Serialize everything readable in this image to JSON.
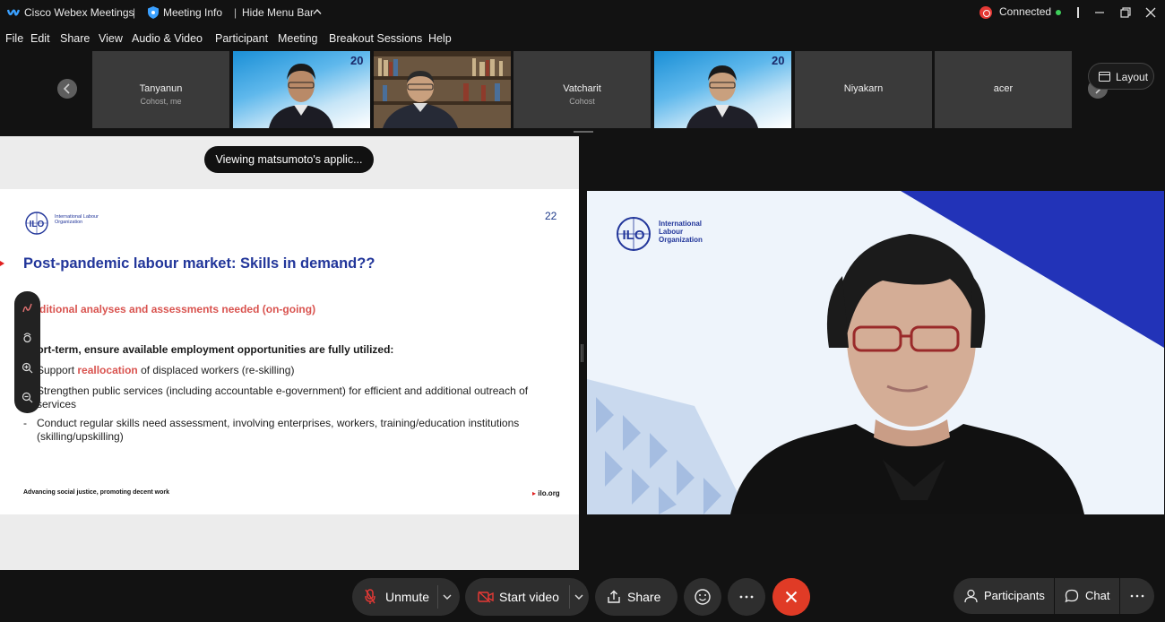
{
  "titlebar": {
    "app_name": "Cisco Webex Meetings",
    "separator": "|",
    "meeting_info": "Meeting Info",
    "hide_menu_bar": "Hide Menu Bar",
    "status": "Connected"
  },
  "menu": {
    "items": [
      "File",
      "Edit",
      "Share",
      "View",
      "Audio & Video",
      "Participant",
      "Meeting",
      "Breakout Sessions",
      "Help"
    ]
  },
  "thumbnails": [
    {
      "name": "Tanyanun",
      "subtitle": "Cohost, me",
      "type": "name"
    },
    {
      "name": "",
      "subtitle": "",
      "type": "video-blue",
      "badge": "20"
    },
    {
      "name": "",
      "subtitle": "",
      "type": "video-shelf"
    },
    {
      "name": "Vatcharit",
      "subtitle": "Cohost",
      "type": "name"
    },
    {
      "name": "",
      "subtitle": "",
      "type": "video-blue",
      "badge": "20"
    },
    {
      "name": "Niyakarn",
      "subtitle": "",
      "type": "name"
    },
    {
      "name": "acer",
      "subtitle": "",
      "type": "name"
    }
  ],
  "layout_button": "Layout",
  "viewing_notice": "Viewing matsumoto's applic...",
  "slide": {
    "page_number": "22",
    "logo_text": "International Labour Organization",
    "title": "Post-pandemic labour market: Skills in demand??",
    "subtitle": "ditional analyses and assessments needed (on-going)",
    "section": "Short-term, ensure available employment opportunities are fully utilized:",
    "bullet1_pre": "Support ",
    "bullet1_hl": "reallocation",
    "bullet1_post": " of displaced workers (re-skilling)",
    "bullet2_line1": "Strengthen public services (including accountable e-government) for efficient and additional outreach of",
    "bullet2_line2": "services",
    "dash": "-",
    "bullet3_line1": "Conduct regular skills need assessment, involving enterprises, workers, training/education institutions",
    "bullet3_line2": "(skilling/upskilling)",
    "footer": "Advancing social justice, promoting decent work",
    "site": "ilo.org"
  },
  "speaker": {
    "logo_text_line1": "International",
    "logo_text_line2": "Labour",
    "logo_text_line3": "Organization"
  },
  "controls": {
    "unmute": "Unmute",
    "start_video": "Start video",
    "share": "Share",
    "participants": "Participants",
    "chat": "Chat"
  },
  "colors": {
    "end_call": "#e03b26",
    "connected_dot": "#3ecf5a",
    "slide_title": "#22369a",
    "slide_highlight": "#d9534f"
  }
}
